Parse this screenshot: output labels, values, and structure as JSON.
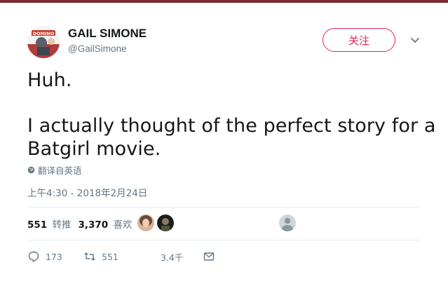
{
  "user": {
    "display_name": "GAIL SIMONE",
    "handle": "@GailSimone"
  },
  "follow_label": "关注",
  "tweet": {
    "lines": [
      "Huh.",
      "I actually thought of the perfect story for a",
      "Batgirl movie."
    ]
  },
  "translate_label": "翻译自英语",
  "timestamp": "上午4:30 - 2018年2月24日",
  "stats": {
    "retweets_count": "551",
    "retweets_label": "转推",
    "likes_count": "3,370",
    "likes_label": "喜欢"
  },
  "actions": {
    "reply_count": "173",
    "retweet_count": "551",
    "like_count": "3.4千"
  },
  "colors": {
    "accent": "#e0245e",
    "muted": "#657786",
    "text": "#14171a",
    "divider": "#e6ecf0"
  }
}
